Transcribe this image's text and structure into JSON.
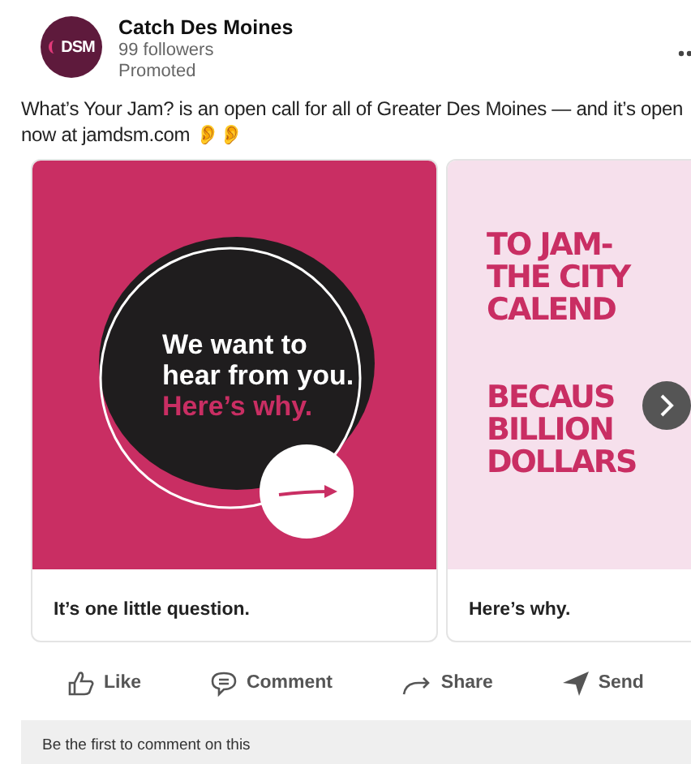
{
  "post": {
    "logo": "DSM",
    "author": "Catch Des Moines",
    "followers": "99 followers",
    "label": "Promoted",
    "text": "What’s Your Jam? is an open call for all of Greater Des Moines — and it’s open now at jamdsm.com 👂👂"
  },
  "carousel": [
    {
      "kind": "circle",
      "lines": [
        "We want to",
        "hear from you."
      ],
      "accent": "Here’s why.",
      "caption": "It’s one little question."
    },
    {
      "kind": "poster",
      "lines": [
        "TO JAM-",
        "THE CITY",
        "CALEND"
      ],
      "lines2": [
        "BECAUS",
        "BILLION",
        "DOLLARS"
      ],
      "caption": "Here’s why."
    }
  ],
  "actions": [
    {
      "kind": "like",
      "label": "Like"
    },
    {
      "kind": "comment",
      "label": "Comment"
    },
    {
      "kind": "share",
      "label": "Share"
    },
    {
      "kind": "send",
      "label": "Send"
    }
  ],
  "comment_prompt": "Be the first to comment on this"
}
